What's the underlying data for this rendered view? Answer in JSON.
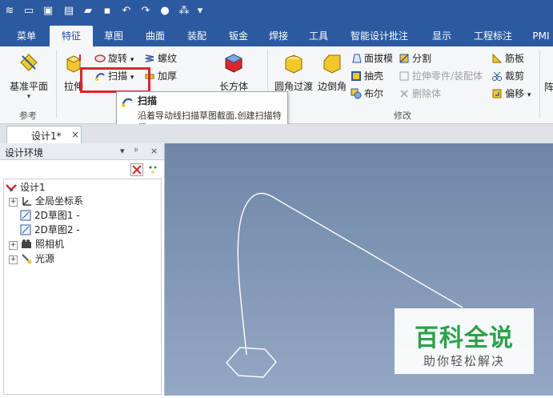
{
  "ribbon_tabs": [
    "菜单",
    "特征",
    "草图",
    "曲面",
    "装配",
    "钣金",
    "焊接",
    "工具",
    "智能设计批注",
    "显示",
    "工程标注",
    "PMI"
  ],
  "active_tab": "特征",
  "groups": {
    "reference": {
      "label": "参考",
      "datum_plane": "基准平面"
    },
    "feature": {
      "extrude": "拉伸",
      "revolve": "旋转",
      "sweep": "扫描",
      "helix": "螺纹",
      "thicken": "加厚",
      "box": "长方体"
    },
    "modify": {
      "label": "修改",
      "fillet": "圆角过渡",
      "chamfer": "边倒角",
      "draft": "面拔模",
      "shell": "抽壳",
      "boolean": "布尔",
      "split": "分割",
      "stretch_part": "拉伸零件/装配体",
      "delete_body": "删除体",
      "rib": "筋板",
      "trim": "裁剪",
      "offset": "偏移",
      "more_label": "阵"
    }
  },
  "tooltip": {
    "title": "扫描",
    "description": "沿着导动线扫描草图截面,创建扫描特征."
  },
  "doc_tab": {
    "label": "设计1*",
    "close": "×"
  },
  "panel": {
    "title": "设计环境",
    "pin": "▾",
    "dock": "ᵖ",
    "close": "×",
    "tree": {
      "root": "设计1",
      "children": [
        "全局坐标系",
        "2D草图1 -",
        "2D草图2 -",
        "照相机",
        "光源"
      ]
    }
  },
  "watermark": {
    "line1": "百科全说",
    "line2": "助你轻松解决"
  },
  "colors": {
    "title_bar": "#2c5aa0",
    "highlight": "#d9262c",
    "viewport_top": "#6f86a7",
    "viewport_bottom": "#93a8c4",
    "watermark_green": "#2aa24a"
  }
}
